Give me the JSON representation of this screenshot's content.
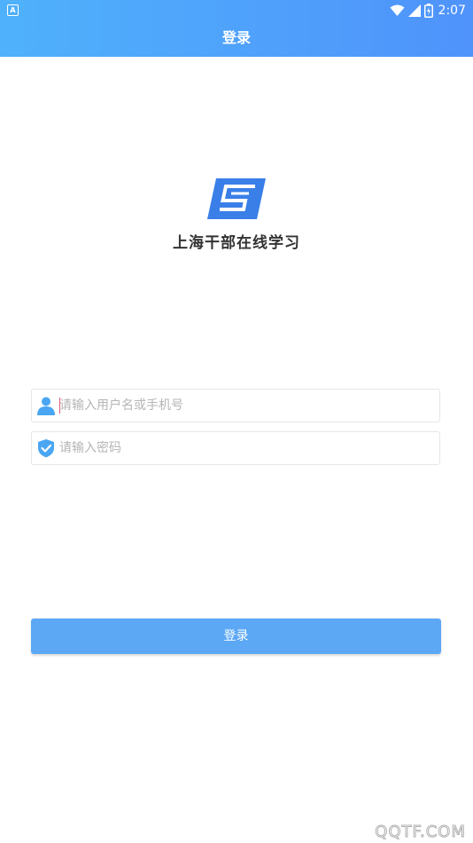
{
  "status_bar": {
    "app_icon_letter": "A",
    "time": "2:07",
    "icons": [
      "wifi-icon",
      "signal-icon",
      "battery-icon"
    ]
  },
  "header": {
    "title": "登录"
  },
  "brand": {
    "app_name": "上海干部在线学习"
  },
  "form": {
    "username_placeholder": "请输入用户名或手机号",
    "password_placeholder": "请输入密码",
    "username_value": "",
    "password_value": ""
  },
  "actions": {
    "login_label": "登录"
  },
  "watermark": "QQTF.COM",
  "colors": {
    "header_gradient_start": "#4fb1fb",
    "header_gradient_end": "#4f93fb",
    "button": "#5ca8f5",
    "logo": "#3a7fe8"
  }
}
